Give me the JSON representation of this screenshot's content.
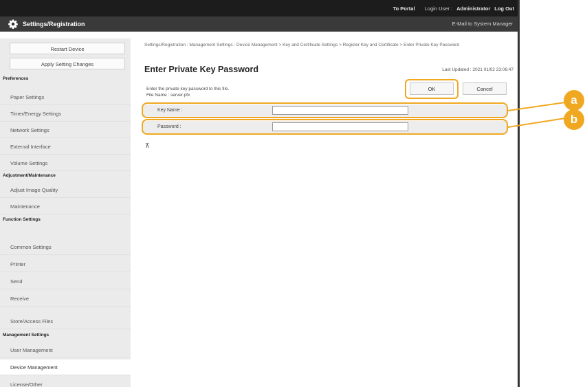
{
  "topbar": {
    "portal": "To Portal",
    "login_user_label": "Login User :",
    "login_user": "Administrator",
    "logout": "Log Out"
  },
  "titlebar": {
    "title": "Settings/Registration",
    "mail": "E-Mail to System Manager"
  },
  "sidebar": {
    "restart": "Restart Device",
    "apply": "Apply Setting Changes",
    "sections": [
      {
        "heading": "Preferences",
        "items": [
          "Paper Settings",
          "Timer/Energy Settings",
          "Network Settings",
          "External Interface",
          "Volume Settings"
        ]
      },
      {
        "heading": "Adjustment/Maintenance",
        "items": [
          "Adjust Image Quality",
          "Maintenance"
        ]
      },
      {
        "heading": "Function Settings",
        "items": [
          "Common Settings",
          "Printer",
          "Send",
          "Receive",
          "Store/Access Files"
        ]
      },
      {
        "heading": "Management Settings",
        "items": [
          "User Management",
          "Device Management",
          "License/Other"
        ]
      }
    ]
  },
  "main": {
    "breadcrumb": "Settings/Registration : Management Settings : Device Management > Key and Certificate Settings > Register Key and Certificate > Enter Private Key Password",
    "title": "Enter Private Key Password",
    "updated": "Last Updated : 2021 01/02 23:06:47",
    "desc_line1": "Enter the private key password to this file.",
    "desc_line2": "File Name : server.pfx",
    "ok": "OK",
    "cancel": "Cancel",
    "key_name_label": "Key Name :",
    "key_name_value": "",
    "password_label": "Password :",
    "password_value": "",
    "to_top": "⊼"
  },
  "callouts": {
    "a": "a",
    "b": "b",
    "color": "#f0a820"
  }
}
